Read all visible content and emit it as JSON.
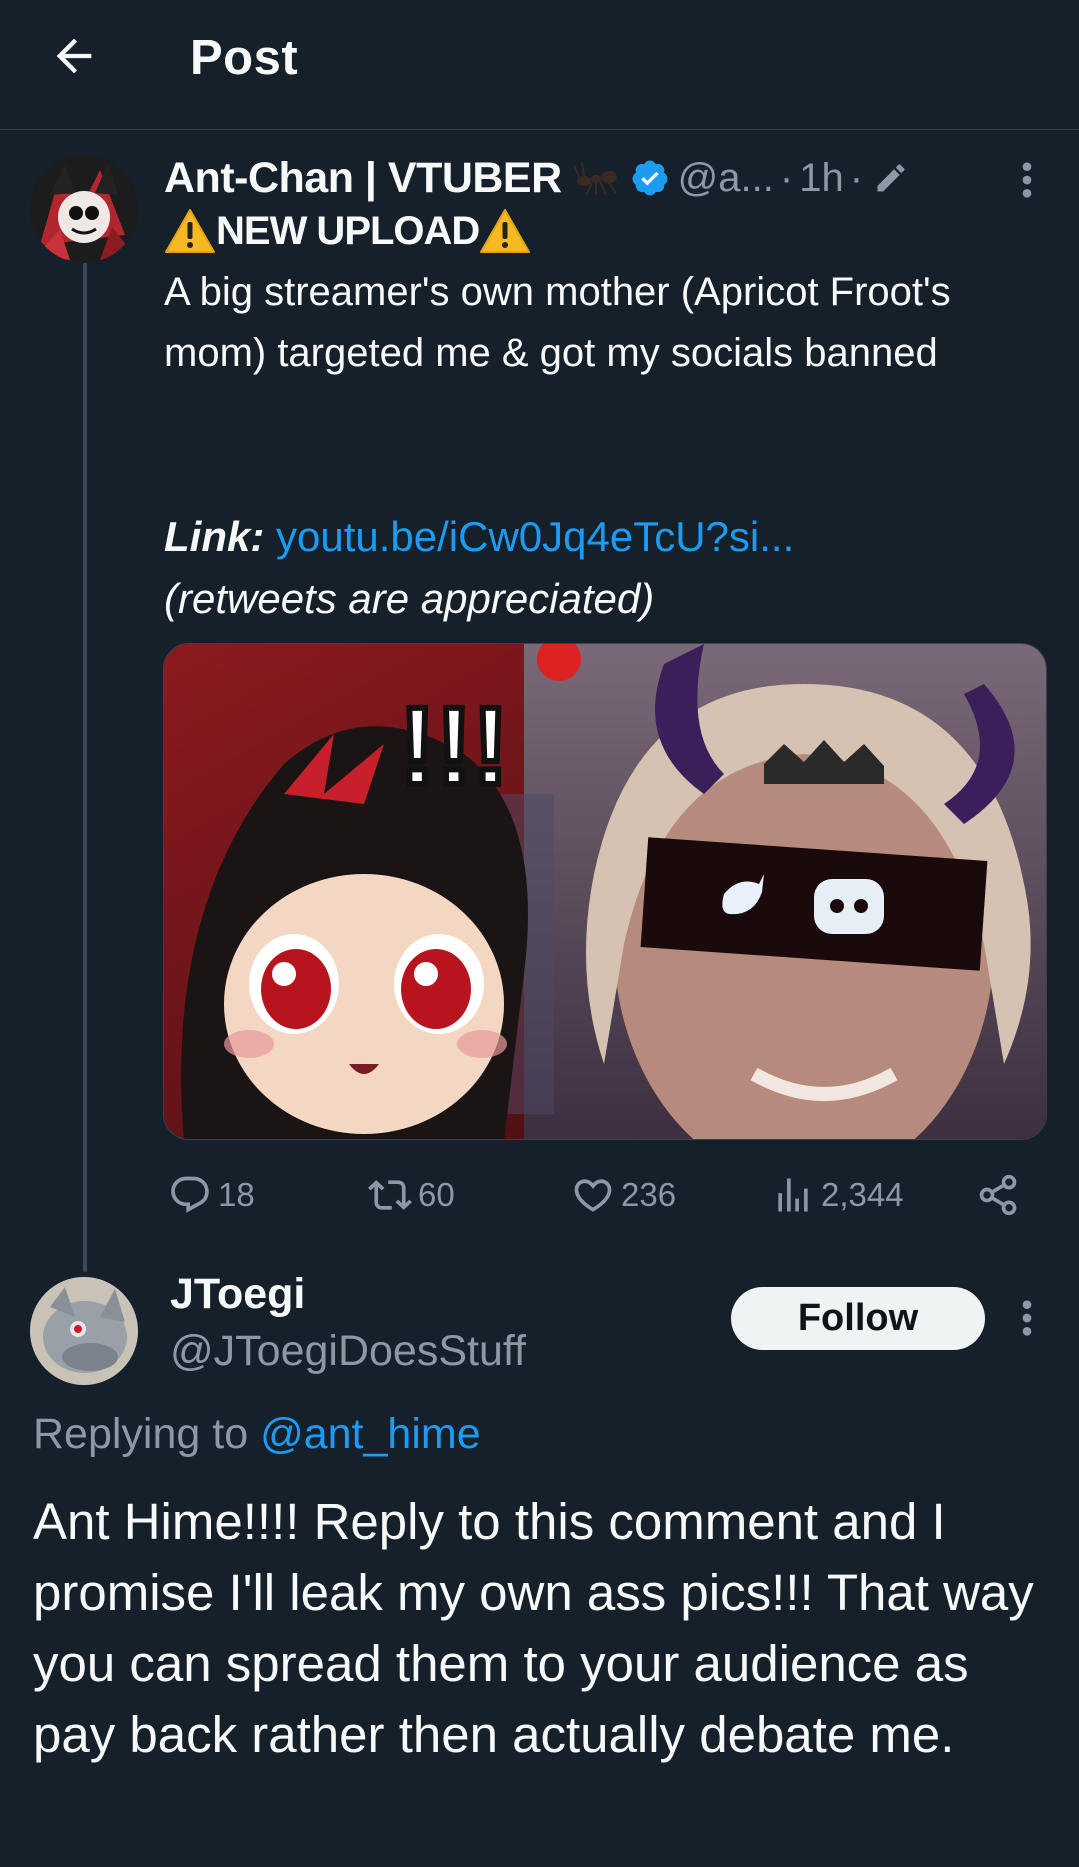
{
  "header": {
    "title": "Post",
    "back_icon": "back-arrow-icon"
  },
  "tweet": {
    "display_name": "Ant-Chan | VTUBER",
    "handle": "@a...",
    "separator": "·",
    "time": "1h",
    "separator2": "·",
    "headline": "NEW UPLOAD",
    "body": "A big streamer's own mother (Apricot Froot's mom) targeted me & got my socials banned",
    "link_label": "Link:",
    "link_url": "youtu.be/iCw0Jq4eTcU?si...",
    "note": "(retweets are appreciated)",
    "media_text": "!!!",
    "stats": {
      "replies": "18",
      "retweets": "60",
      "likes": "236",
      "views": "2,344"
    }
  },
  "reply": {
    "display_name": "JToegi",
    "handle": "@JToegiDoesStuff",
    "follow_label": "Follow",
    "replying_prefix": "Replying to ",
    "replying_mention": "@ant_hime",
    "body": "Ant Hime!!!! Reply to this comment and I promise I'll leak my own ass pics!!! That way you can spread them to your audience as pay back rather then actually debate me."
  },
  "colors": {
    "background": "#15202b",
    "link": "#1d9bf0",
    "muted": "#8b98a5",
    "divider": "#38444d",
    "follow_bg": "#eff3f4"
  }
}
